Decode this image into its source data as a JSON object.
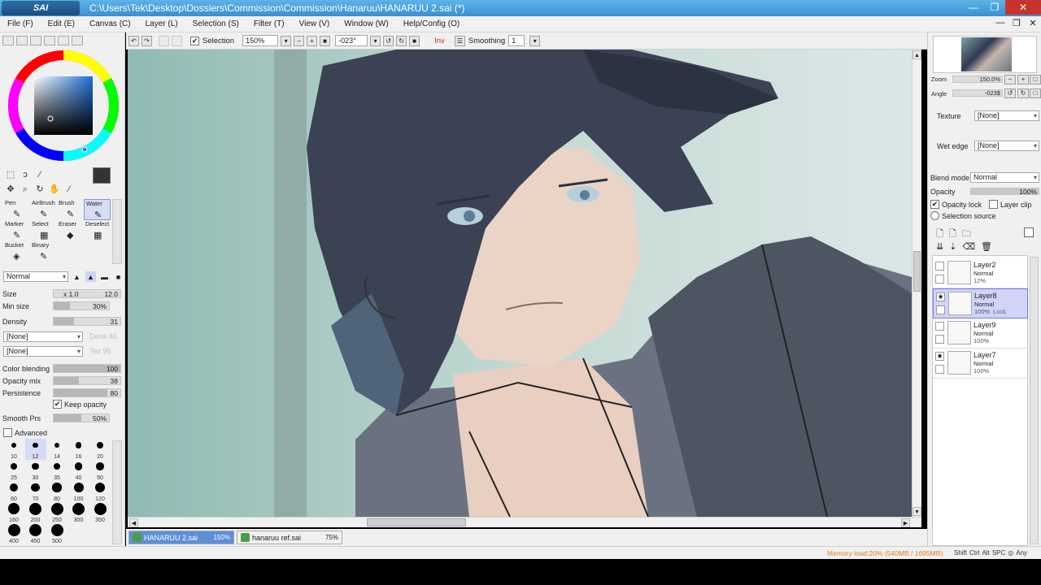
{
  "titlebar": {
    "app_logo": "SAI",
    "title": "C:\\Users\\Tek\\Desktop\\Dossiers\\Commission\\Commission\\Hanaruu\\HANARUU 2.sai (*)",
    "minimize": "—",
    "maximize": "❐",
    "close": "✕"
  },
  "menu": {
    "items": [
      "File (F)",
      "Edit (E)",
      "Canvas (C)",
      "Layer (L)",
      "Selection (S)",
      "Filter (T)",
      "View (V)",
      "Window (W)",
      "Help/Config (O)"
    ],
    "min": "—",
    "restore": "❐",
    "close": "✕"
  },
  "canvas_toolbar": {
    "selection_label": "Selection",
    "zoom": "150%",
    "angle": "-023°",
    "inv_label": "Inv",
    "smoothing_label": "Smoothing",
    "smoothing_value": "1"
  },
  "tools": {
    "brushes": [
      {
        "label": "Pen",
        "icon": "pen-icon"
      },
      {
        "label": "AirBrush",
        "icon": "airbrush-icon"
      },
      {
        "label": "Brush",
        "icon": "brush-icon"
      },
      {
        "label": "Water",
        "icon": "water-icon",
        "selected": true
      },
      {
        "label": "Marker",
        "icon": "marker-icon"
      },
      {
        "label": "Select",
        "icon": "select-icon"
      },
      {
        "label": "Eraser",
        "icon": "eraser-icon"
      },
      {
        "label": "Deselect",
        "icon": "deselect-icon"
      },
      {
        "label": "Bucket",
        "icon": "bucket-icon"
      },
      {
        "label": "Binary",
        "icon": "binary-icon"
      }
    ],
    "blend_mode": "Normal"
  },
  "brush_params": {
    "size_label": "Size",
    "size_mult": "x 1.0",
    "size_value": "12.0",
    "min_size_label": "Min size",
    "min_size_value": "30%",
    "density_label": "Density",
    "density_value": "31",
    "tex1": "[None]",
    "tex1_val": "Dens 40",
    "tex2": "[None]",
    "tex2_val": "Tex 95",
    "color_blending_label": "Color blending",
    "color_blending_value": "100",
    "opacity_mix_label": "Opacity mix",
    "opacity_mix_value": "38",
    "persistence_label": "Persistence",
    "persistence_value": "80",
    "keep_opacity_label": "Keep opacity",
    "smooth_prs_label": "Smooth Prs",
    "smooth_prs_value": "50%",
    "advanced_label": "Advanced"
  },
  "brush_sizes": [
    "10",
    "12",
    "14",
    "16",
    "20",
    "25",
    "30",
    "35",
    "40",
    "50",
    "60",
    "70",
    "80",
    "100",
    "120",
    "160",
    "200",
    "250",
    "300",
    "350",
    "400",
    "450",
    "500"
  ],
  "documents": [
    {
      "name": "HANARUU 2.sai",
      "zoom": "150%",
      "active": true
    },
    {
      "name": "hanaruu ref.sai",
      "zoom": "75%",
      "active": false
    }
  ],
  "navigator": {
    "zoom_label": "Zoom",
    "zoom_value": "150.0%",
    "angle_label": "Angle",
    "angle_value": "-023$"
  },
  "layer_props": {
    "texture_label": "Texture",
    "texture_value": "[None]",
    "wet_edge_label": "Wet edge",
    "wet_edge_value": "[None]",
    "blend_mode_label": "Blend mode",
    "blend_mode_value": "Normal",
    "opacity_label": "Opacity",
    "opacity_value": "100%",
    "opacity_lock_label": "Opacity lock",
    "layer_clip_label": "Layer clip",
    "selection_source_label": "Selection source"
  },
  "layers": [
    {
      "name": "Layer2",
      "mode": "Normal",
      "opacity": "12%",
      "visible": false,
      "selected": false,
      "lock": ""
    },
    {
      "name": "Layer8",
      "mode": "Normal",
      "opacity": "100%",
      "visible": true,
      "selected": true,
      "lock": "Lock"
    },
    {
      "name": "Layer9",
      "mode": "Normal",
      "opacity": "100%",
      "visible": false,
      "selected": false,
      "lock": ""
    },
    {
      "name": "Layer7",
      "mode": "Normal",
      "opacity": "100%",
      "visible": true,
      "selected": false,
      "lock": ""
    }
  ],
  "status": {
    "memory": "Memory load:20% (540MB / 1695MB)",
    "keys": [
      "Shift",
      "Ctrl",
      "Alt",
      "SPC",
      "◎",
      "Any"
    ]
  },
  "colors": {
    "titlebar": "#3a8fd0",
    "close_button": "#c7342d",
    "selection_highlight": "#cfd4f8",
    "memory_text": "#e07e20"
  }
}
